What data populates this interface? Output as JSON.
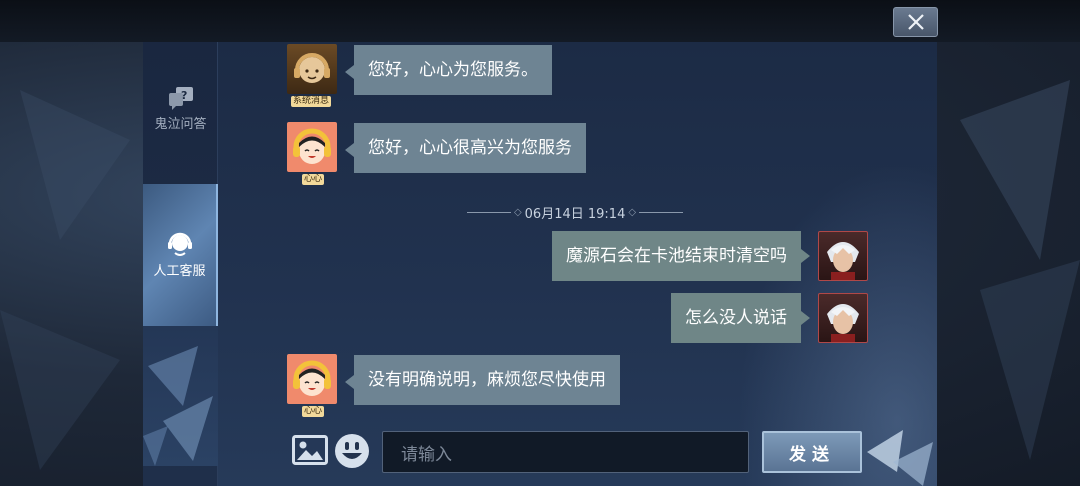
{
  "sidebar": {
    "items": [
      {
        "label": "鬼泣问答",
        "icon": "question-chat-icon",
        "active": false
      },
      {
        "label": "人工客服",
        "icon": "headset-icon",
        "active": true
      }
    ]
  },
  "messages": [
    {
      "side": "left",
      "sender_tag": "系统消息",
      "avatar": "system-avatar",
      "text": "您好，心心为您服务。"
    },
    {
      "side": "left",
      "sender_tag": "心心",
      "avatar": "xinxin-avatar",
      "text": "您好，心心很高兴为您服务"
    },
    {
      "side": "right",
      "avatar": "player-avatar",
      "text": "魔源石会在卡池结束时清空吗"
    },
    {
      "side": "right",
      "avatar": "player-avatar",
      "text": "怎么没人说话"
    },
    {
      "side": "left",
      "sender_tag": "心心",
      "avatar": "xinxin-avatar",
      "text": "没有明确说明，麻烦您尽快使用"
    }
  ],
  "timestamp": "06月14日 19:14",
  "input": {
    "placeholder": "请输入",
    "value": ""
  },
  "send_label": "发送",
  "icons": {
    "close": "close-icon",
    "image": "image-icon",
    "emoji": "emoji-icon"
  },
  "colors": {
    "panel": "#21324f",
    "bubble_left": "#6e8493",
    "bubble_right": "#6f8687",
    "sidebar_active": "#5f85b2"
  }
}
